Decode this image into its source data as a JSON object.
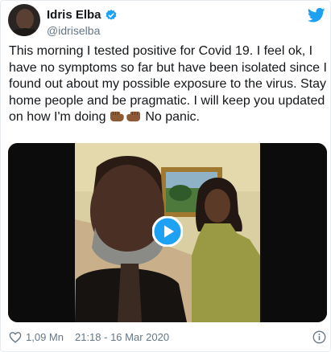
{
  "author": {
    "display_name": "Idris Elba",
    "handle": "@idriselba"
  },
  "tweet": {
    "text_part1": "This morning I tested positive for Covid 19. I feel ok, I have no symptoms so far but have been isolated since I found out about my possible exposure to the virus. Stay home people and be pragmatic. I will keep you updated on how I'm doing ",
    "text_part2": " No panic."
  },
  "media": {
    "type": "video"
  },
  "footer": {
    "likes": "1,09 Mn",
    "timestamp": "21:18 - 16 Mar 2020"
  },
  "colors": {
    "twitter_blue": "#1da1f2",
    "secondary_text": "#657786",
    "primary_text": "#14171a"
  },
  "icons": {
    "verified": "verified-badge-icon",
    "brand": "twitter-bird-icon",
    "play": "play-icon",
    "like": "heart-icon",
    "info": "info-icon"
  }
}
